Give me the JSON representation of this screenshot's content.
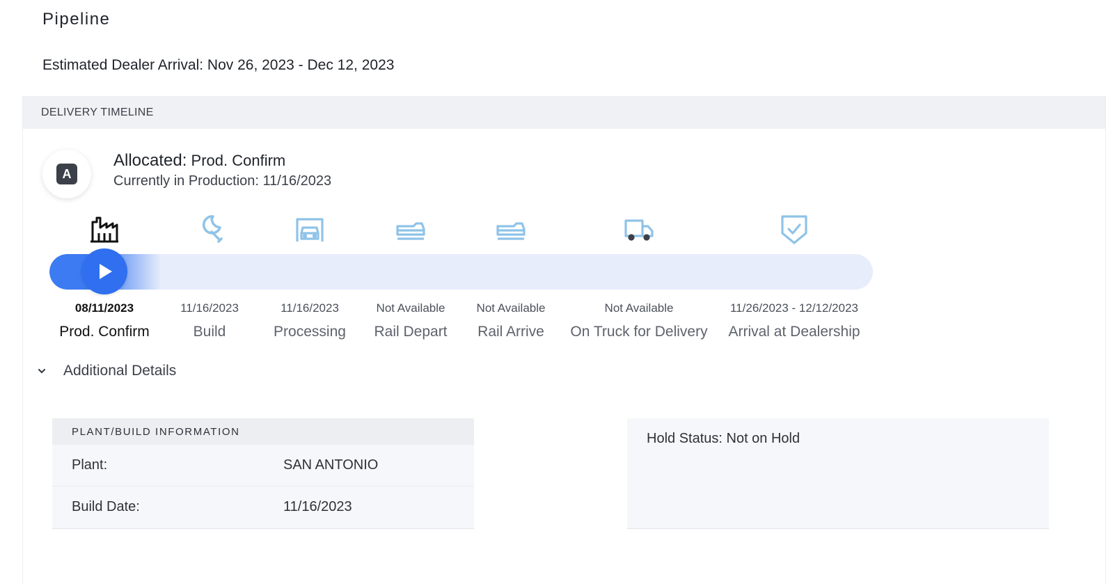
{
  "page": {
    "title": "Pipeline",
    "eta_text": "Estimated Dealer Arrival: Nov 26, 2023 - Dec 12, 2023"
  },
  "timeline": {
    "header": "DELIVERY TIMELINE",
    "avatar_letter": "A",
    "status_label": "Allocated:",
    "status_value": "Prod. Confirm",
    "status_sub": "Currently in Production: 11/16/2023",
    "progress_fraction": 0.12,
    "active_color": "#2f6ff0",
    "inactive_icon_color": "#8fc3e8",
    "stages": [
      {
        "name": "Prod. Confirm",
        "date": "08/11/2023",
        "icon": "factory-icon",
        "active": true
      },
      {
        "name": "Build",
        "date": "11/16/2023",
        "icon": "wrench-icon",
        "active": false
      },
      {
        "name": "Processing",
        "date": "11/16/2023",
        "icon": "car-garage-icon",
        "active": false
      },
      {
        "name": "Rail Depart",
        "date": "Not Available",
        "icon": "rail-car-icon",
        "active": false
      },
      {
        "name": "Rail Arrive",
        "date": "Not Available",
        "icon": "rail-car-icon",
        "active": false
      },
      {
        "name": "On Truck for Delivery",
        "date": "Not Available",
        "icon": "truck-icon",
        "active": false
      },
      {
        "name": "Arrival at Dealership",
        "date": "11/26/2023 - 12/12/2023",
        "icon": "shield-check-icon",
        "active": false
      }
    ]
  },
  "additional": {
    "label": "Additional Details",
    "plant_build": {
      "header": "PLANT/BUILD INFORMATION",
      "rows": [
        {
          "label": "Plant:",
          "value": "SAN ANTONIO"
        },
        {
          "label": "Build Date:",
          "value": "11/16/2023"
        }
      ]
    },
    "hold_status": "Hold Status: Not on Hold"
  }
}
